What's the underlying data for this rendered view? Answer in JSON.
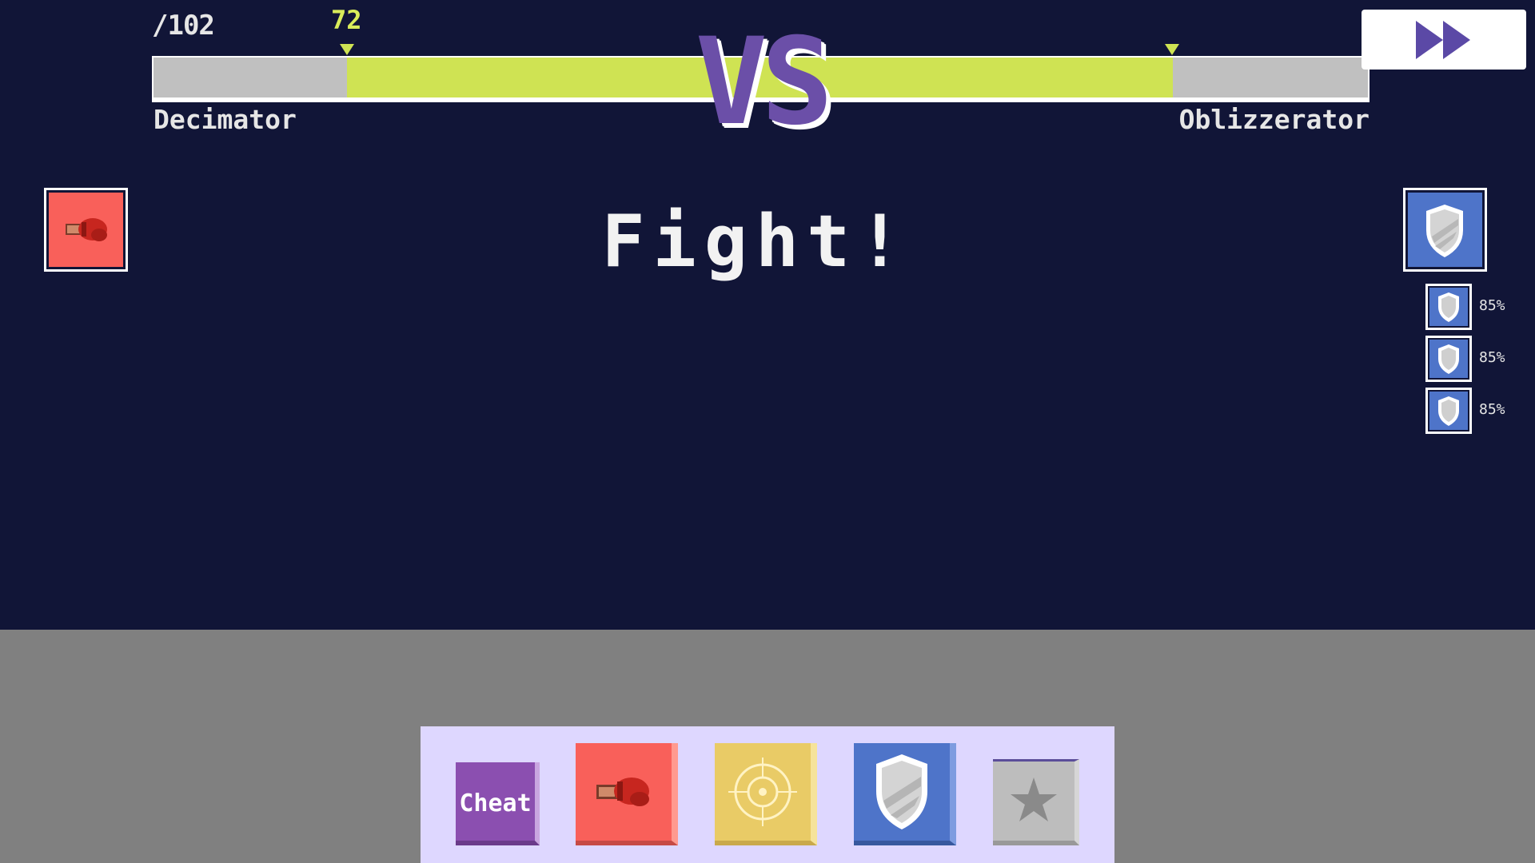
{
  "hud": {
    "hp_max": "/102",
    "hp_current": "72",
    "player_left": "Decimator",
    "player_right": "Oblizzerator",
    "vs_label": "VS",
    "fast_forward_icon": "fast-forward-icon"
  },
  "arena": {
    "announcement": "Fight!",
    "left_action_icon": "boxing-glove-icon",
    "right_action_icon": "shield-icon",
    "buffs": [
      {
        "icon": "shield-icon",
        "percent": "85%"
      },
      {
        "icon": "shield-icon",
        "percent": "85%"
      },
      {
        "icon": "shield-icon",
        "percent": "85%"
      }
    ]
  },
  "skills": {
    "cheat_label": "Cheat",
    "items": [
      {
        "name": "cheat",
        "color": "#8b4fb0"
      },
      {
        "name": "attack",
        "icon": "boxing-glove-icon",
        "color": "#f9605a"
      },
      {
        "name": "target",
        "icon": "crosshair-icon",
        "color": "#e9cb66"
      },
      {
        "name": "shield",
        "icon": "shield-icon",
        "color": "#4e74c9"
      },
      {
        "name": "special",
        "icon": "star-icon",
        "color": "#bdbdbd"
      }
    ]
  },
  "colors": {
    "arena_bg": "#111537",
    "hp_fill": "#cfe353",
    "hp_empty": "#c0c0c0",
    "vs_purple": "#6b4fa8",
    "panel_bg": "#ded7ff"
  }
}
